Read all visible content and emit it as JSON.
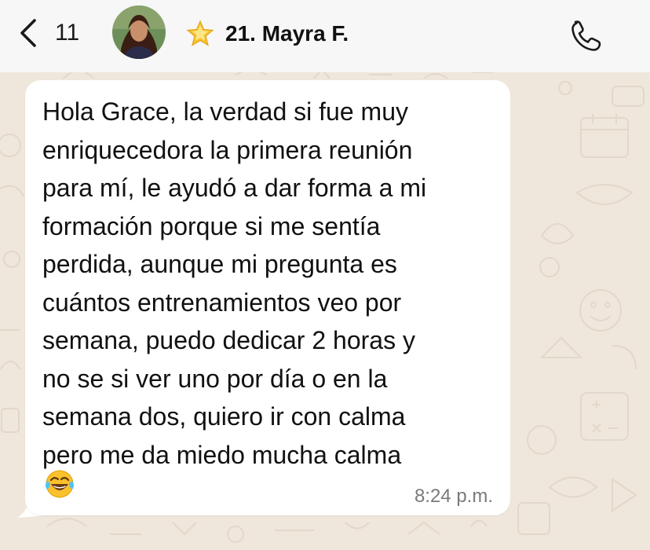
{
  "header": {
    "back_count": "11",
    "contact_name": "21. Mayra F.",
    "name_emoji_icon": "glowing-star",
    "call_icon": "phone-icon"
  },
  "message": {
    "text": "Hola Grace, la verdad si fue muy\nenriquecedora la primera reunión\npara mí, le ayudó a dar forma a mi\nformación porque si me sentía\nperdida, aunque mi pregunta es\ncuántos entrenamientos veo por\nsemana, puedo dedicar 2 horas y\nno se si ver uno por día o en la\nsemana dos, quiero ir con calma\npero me da miedo mucha calma",
    "emoji": "face-with-tears-of-joy",
    "time": "8:24 p.m."
  },
  "colors": {
    "background": "#efe7dc",
    "header_bg": "#f7f7f7",
    "bubble_bg": "#ffffff",
    "timestamp": "#7a7a7a"
  }
}
